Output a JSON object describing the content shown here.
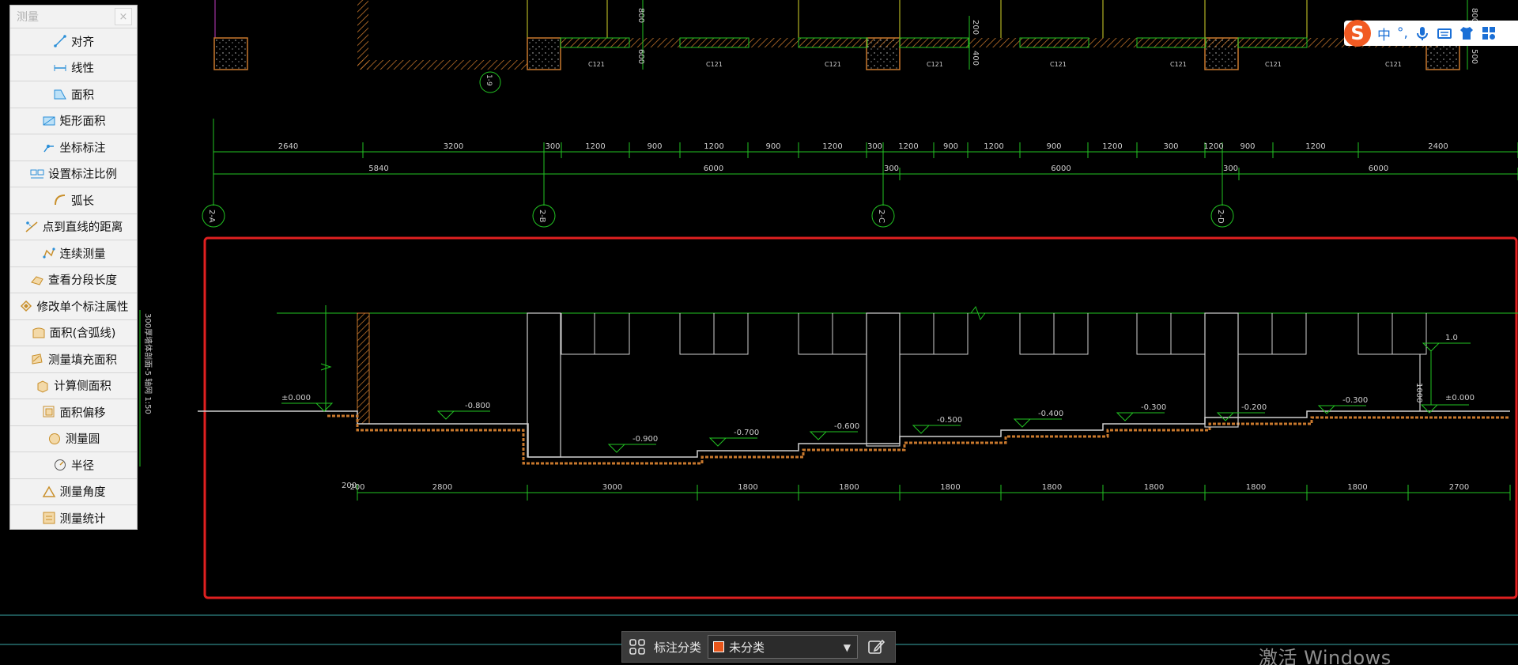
{
  "panel": {
    "title": "测量",
    "close": "×",
    "items": [
      {
        "label": "对齐",
        "icon": "align-icon"
      },
      {
        "label": "线性",
        "icon": "linear-icon"
      },
      {
        "label": "面积",
        "icon": "area-icon"
      },
      {
        "label": "矩形面积",
        "icon": "rect-area-icon"
      },
      {
        "label": "坐标标注",
        "icon": "coordinate-icon"
      },
      {
        "label": "设置标注比例",
        "icon": "scale-icon"
      },
      {
        "label": "弧长",
        "icon": "arc-length-icon"
      },
      {
        "label": "点到直线的距离",
        "icon": "point-line-distance-icon"
      },
      {
        "label": "连续测量",
        "icon": "continuous-measure-icon"
      },
      {
        "label": "查看分段长度",
        "icon": "segment-length-icon"
      },
      {
        "label": "修改单个标注属性",
        "icon": "edit-annotation-icon"
      },
      {
        "label": "面积(含弧线)",
        "icon": "arc-area-icon"
      },
      {
        "label": "测量填充面积",
        "icon": "fill-area-icon"
      },
      {
        "label": "计算侧面积",
        "icon": "side-area-icon"
      },
      {
        "label": "面积偏移",
        "icon": "area-offset-icon"
      },
      {
        "label": "测量圆",
        "icon": "circle-icon"
      },
      {
        "label": "半径",
        "icon": "radius-icon"
      },
      {
        "label": "测量角度",
        "icon": "angle-icon"
      },
      {
        "label": "测量统计",
        "icon": "statistics-icon"
      }
    ]
  },
  "ime": {
    "logo": "S",
    "lang": "中",
    "punct": "°,"
  },
  "bottom_bar": {
    "label": "标注分类",
    "selected": "未分类",
    "swatch_color": "#e8561b"
  },
  "watermark": "激活 Windows",
  "drawing": {
    "top_dims_row1": [
      "2640",
      "3200",
      "300",
      "1200",
      "900",
      "1200",
      "900",
      "1200",
      "300",
      "1200",
      "900",
      "1200",
      "900",
      "1200",
      "300",
      "1200",
      "900",
      "1200",
      "2400"
    ],
    "top_dims_row2": [
      "5840",
      "6000",
      "300",
      "6000",
      "300",
      "6000"
    ],
    "axis_labels": [
      "2-A",
      "2-B",
      "2-C",
      "2-D"
    ],
    "top_axis": "1-9",
    "top_vertical_dims": [
      "800",
      "600",
      "200",
      "400",
      "800",
      "500"
    ],
    "beam_labels": [
      "C121",
      "C121",
      "C121",
      "C121",
      "C121",
      "C121",
      "C121",
      "C121"
    ],
    "section_title": "300厚墙体剖面-5 轴网 1:50",
    "elevations": [
      "±0.000",
      "-0.800",
      "-0.900",
      "-0.700",
      "-0.600",
      "-0.500",
      "-0.400",
      "-0.300",
      "-0.200",
      "-0.300",
      "±0.000",
      "1.0"
    ],
    "wall_height": "1000",
    "bottom_dims": [
      "200",
      "2800",
      "3000",
      "1800",
      "1800",
      "1800",
      "1800",
      "1800",
      "1800",
      "1800",
      "2700"
    ]
  }
}
